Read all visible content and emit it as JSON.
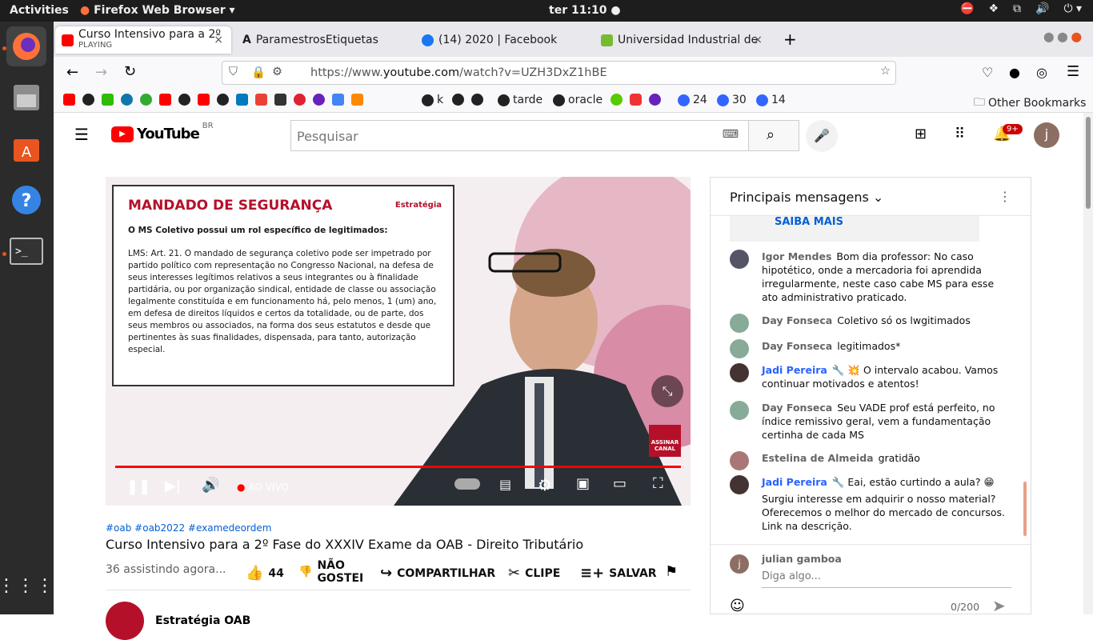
{
  "system": {
    "activities": "Activities",
    "app": "Firefox Web Browser",
    "clock": "ter 11:10"
  },
  "tabs": [
    {
      "title": "Curso Intensivo para a 2º",
      "sub": "PLAYING"
    },
    {
      "title": "ParamestrosEtiquetas"
    },
    {
      "title": "(14) 2020 | Facebook"
    },
    {
      "title": "Universidad Industrial de"
    }
  ],
  "url": {
    "prefix": "https://www.",
    "domain": "youtube.com",
    "path": "/watch?v=UZH3DxZ1hBE"
  },
  "bookmarks": {
    "tarde": "tarde",
    "oracle": "oracle",
    "k": "k",
    "c24": "24",
    "c30": "30",
    "c14": "14",
    "other": "Other Bookmarks"
  },
  "youtube": {
    "logo": "YouTube",
    "region": "BR",
    "search_placeholder": "Pesquisar",
    "notif_badge": "9+",
    "avatar": "j"
  },
  "video": {
    "slide_title": "MANDADO DE SEGURANÇA",
    "slide_brand": "Estratégia",
    "slide_line1": "O MS Coletivo possui um rol específico de legitimados:",
    "slide_body": "LMS: Art. 21. O mandado de segurança coletivo pode ser impetrado por partido político com representação no Congresso Nacional, na defesa de seus interesses legítimos relativos a seus integrantes ou à finalidade partidária, ou por organização sindical, entidade de classe ou associação legalmente constituída e em funcionamento há, pelo menos, 1 (um) ano, em defesa de direitos líquidos e certos da totalidade, ou de parte, dos seus membros ou associados, na forma dos seus estatutos e desde que pertinentes às suas finalidades, dispensada, para tanto, autorização especial.",
    "subscribe": "ASSINAR CANAL",
    "live": "AO VIVO"
  },
  "meta": {
    "tags": "#oab #oab2022 #examedeordem",
    "title": "Curso Intensivo para a 2º Fase do XXXIV Exame da OAB - Direito Tributário",
    "watching": "36 assistindo agora...",
    "likes": "44",
    "dislike": "NÃO GOSTEI",
    "share": "COMPARTILHAR",
    "clip": "CLIPE",
    "save": "SALVAR",
    "channel": "Estratégia OAB"
  },
  "chat": {
    "header": "Principais mensagens",
    "saiba": "SAIBA MAIS",
    "messages": [
      {
        "author": "Igor Mendes",
        "text": "Bom dia professor: No caso hipotético, onde a mercadoria foi aprendida irregularmente, neste caso cabe MS para esse ato administrativo praticado."
      },
      {
        "author": "Day Fonseca",
        "text": "Coletivo só os lwgitimados"
      },
      {
        "author": "Day Fonseca",
        "text": "legitimados*"
      },
      {
        "author": "Jadi Pereira",
        "text": "O intervalo acabou. Vamos continuar motivados e atentos!"
      },
      {
        "author": "Day Fonseca",
        "text": "Seu VADE prof está perfeito, no índice remissivo geral, vem a fundamentação certinha de cada MS"
      },
      {
        "author": "Estelina de Almeida",
        "text": "gratidão"
      },
      {
        "author": "Jadi Pereira",
        "text": "Eai, estão curtindo a aula?"
      },
      {
        "author": "",
        "text": "Surgiu interesse em adquirir o nosso material? Oferecemos o melhor do mercado de concursos. Link na descrição."
      }
    ],
    "input_user": "julian gamboa",
    "input_placeholder": "Diga algo...",
    "counter": "0/200",
    "input_avatar": "j"
  }
}
